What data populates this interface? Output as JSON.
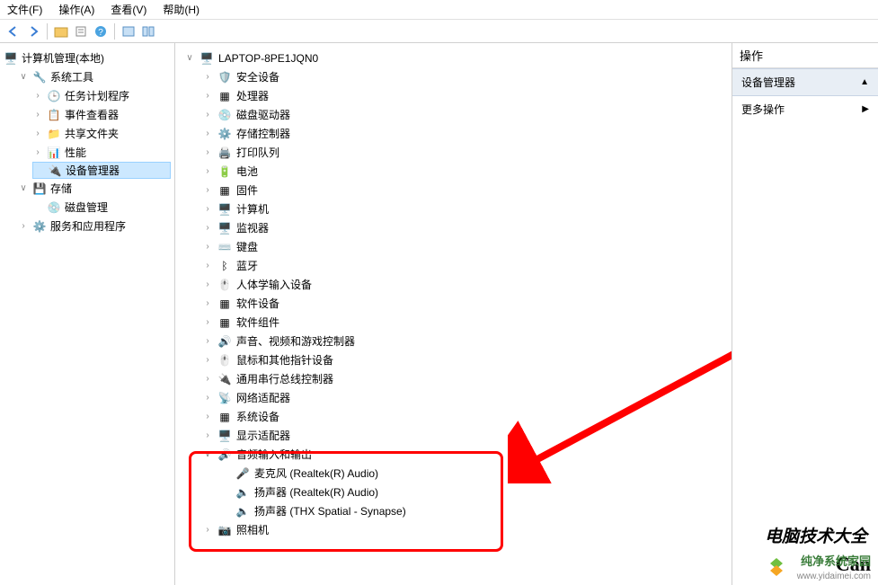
{
  "menu": {
    "file": "文件(F)",
    "action": "操作(A)",
    "view": "查看(V)",
    "help": "帮助(H)"
  },
  "left": {
    "root": "计算机管理(本地)",
    "sys_tools": "系统工具",
    "task_sched": "任务计划程序",
    "event_viewer": "事件查看器",
    "shared": "共享文件夹",
    "perf": "性能",
    "devmgr": "设备管理器",
    "storage": "存储",
    "diskmgmt": "磁盘管理",
    "services": "服务和应用程序"
  },
  "dev": {
    "root": "LAPTOP-8PE1JQN0",
    "items": [
      "安全设备",
      "处理器",
      "磁盘驱动器",
      "存储控制器",
      "打印队列",
      "电池",
      "固件",
      "计算机",
      "监视器",
      "键盘",
      "蓝牙",
      "人体学输入设备",
      "软件设备",
      "软件组件",
      "声音、视频和游戏控制器",
      "鼠标和其他指针设备",
      "通用串行总线控制器",
      "网络适配器",
      "系统设备",
      "显示适配器"
    ],
    "audio": {
      "label": "音频输入和输出",
      "mic": "麦克风 (Realtek(R) Audio)",
      "sp1": "扬声器 (Realtek(R) Audio)",
      "sp2": "扬声器 (THX Spatial - Synapse)"
    },
    "camera": "照相机"
  },
  "right": {
    "title": "操作",
    "section": "设备管理器",
    "more": "更多操作"
  },
  "wm": {
    "t1": "电脑技术大全",
    "t2": "Can",
    "t3": "纯净系统家园",
    "t4": "www.yidaimei.com"
  }
}
